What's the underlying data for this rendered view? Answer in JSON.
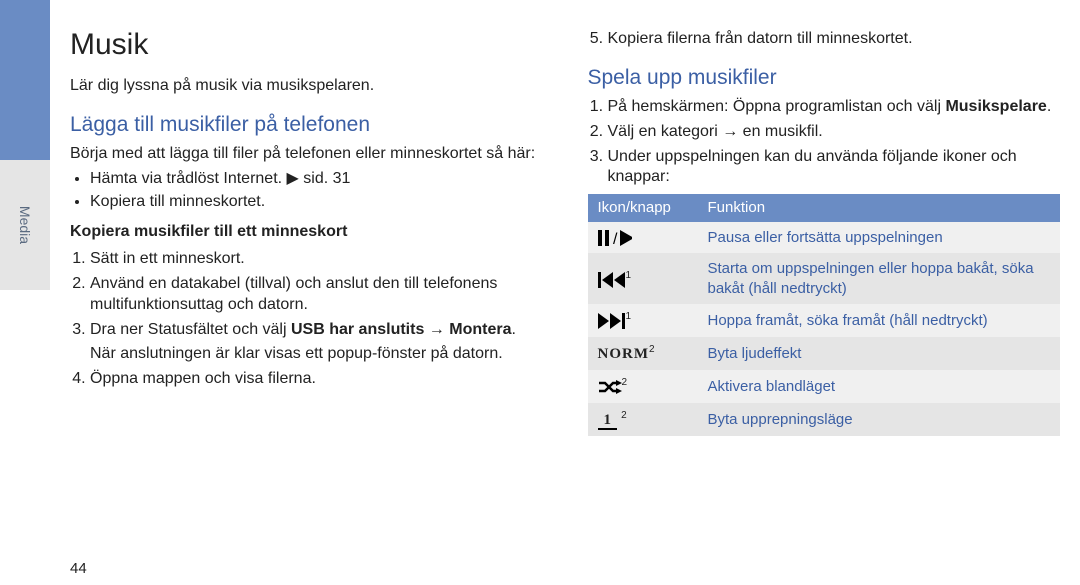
{
  "sidebar": {
    "label": "Media"
  },
  "page_number": "44",
  "left": {
    "title": "Musik",
    "intro": "Lär dig lyssna på musik via musikspelaren.",
    "h2_add": "Lägga till musikfiler på telefonen",
    "add_intro": "Börja med att lägga till filer på telefonen eller minneskortet så här:",
    "bullet1a": "Hämta via trådlöst Internet. ",
    "bullet1b": " sid. 31",
    "bullet2": "Kopiera till minneskortet.",
    "h3_copy": "Kopiera musikfiler till ett minneskort",
    "steps": {
      "s1": "Sätt in ett minneskort.",
      "s2": "Använd en datakabel (tillval) och anslut den till telefonens multifunktionsuttag och datorn.",
      "s3a": "Dra ner Statusfältet och välj ",
      "s3b_bold": "USB har anslutits",
      "s3c": " → ",
      "s3d_bold": "Montera",
      "s3e": ".",
      "s3_note": "När anslutningen är klar visas ett popup-fönster på datorn.",
      "s4": "Öppna mappen och visa filerna."
    }
  },
  "right": {
    "step5": "Kopiera filerna från datorn till minneskortet.",
    "h2_play": "Spela upp musikfiler",
    "p1a": "På hemskärmen: Öppna programlistan och välj ",
    "p1b_bold": "Musikspelare",
    "p1c": ".",
    "p2": "Välj en kategori → en musikfil.",
    "p3": "Under uppspelningen kan du använda följande ikoner och knappar:",
    "table": {
      "th1": "Ikon/knapp",
      "th2": "Funktion",
      "rows": [
        {
          "iconName": "pause-play-icon",
          "sup": "",
          "func": "Pausa eller fortsätta uppspelningen"
        },
        {
          "iconName": "skip-back-icon",
          "sup": "1",
          "func": "Starta om uppspelningen eller hoppa bakåt, söka bakåt (håll nedtryckt)"
        },
        {
          "iconName": "skip-forward-icon",
          "sup": "1",
          "func": "Hoppa framåt, söka framåt (håll nedtryckt)"
        },
        {
          "iconName": "norm-icon",
          "sup": "2",
          "func": "Byta ljudeffekt",
          "textIcon": "NORM"
        },
        {
          "iconName": "shuffle-icon",
          "sup": "2",
          "func": "Aktivera blandläget"
        },
        {
          "iconName": "repeat-one-icon",
          "sup": "2",
          "func": "Byta upprepningsläge",
          "textIcon": "1"
        }
      ]
    }
  }
}
